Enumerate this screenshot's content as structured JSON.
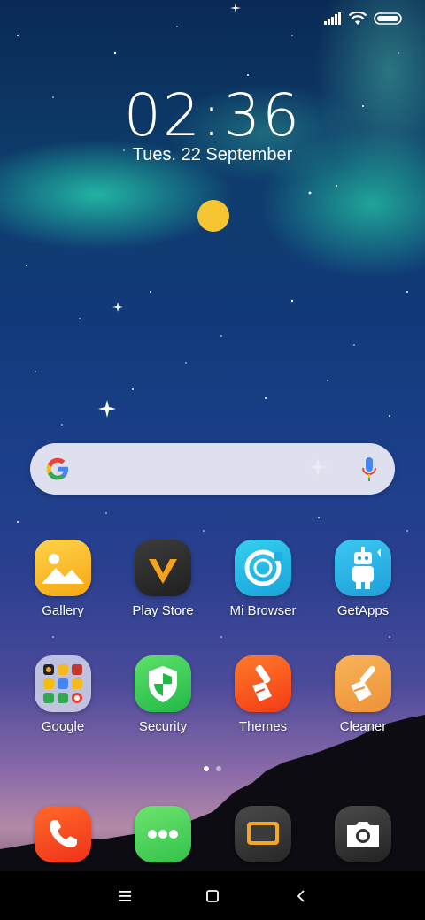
{
  "status_bar": {
    "icons": [
      "signal-icon",
      "wifi-icon",
      "battery-icon"
    ]
  },
  "clock": {
    "time": "02:36",
    "date": "Tues. 22 September"
  },
  "search_bar": {
    "icons": [
      "google-logo-icon",
      "microphone-icon"
    ]
  },
  "apps": [
    {
      "label": "Gallery",
      "icon": "gallery-icon"
    },
    {
      "label": "Play Store",
      "icon": "play-store-icon"
    },
    {
      "label": "Mi Browser",
      "icon": "mi-browser-icon"
    },
    {
      "label": "GetApps",
      "icon": "getapps-icon"
    },
    {
      "label": "Google",
      "icon": "google-folder-icon"
    },
    {
      "label": "Security",
      "icon": "security-icon"
    },
    {
      "label": "Themes",
      "icon": "themes-icon"
    },
    {
      "label": "Cleaner",
      "icon": "cleaner-icon"
    }
  ],
  "page_indicator": {
    "count": 2,
    "active": 1
  },
  "dock": [
    {
      "icon": "phone-icon"
    },
    {
      "icon": "messaging-icon"
    },
    {
      "icon": "screen-recorder-icon"
    },
    {
      "icon": "camera-icon"
    }
  ],
  "nav_bar": {
    "icons": [
      "menu-icon",
      "home-icon",
      "back-icon"
    ]
  },
  "colors": {
    "sun": "#f7c531",
    "gallery": "#f9b81e",
    "play_store": "#2b2b2b",
    "mi_browser": "#23b6e8",
    "getapps": "#2fb8e8",
    "security": "#3ed05a",
    "themes": "#ff5a1f",
    "cleaner": "#f5a34a",
    "phone": "#ff4a1c",
    "messaging": "#4cd964",
    "screen_recorder": "#3a3a3a",
    "camera": "#333333"
  }
}
